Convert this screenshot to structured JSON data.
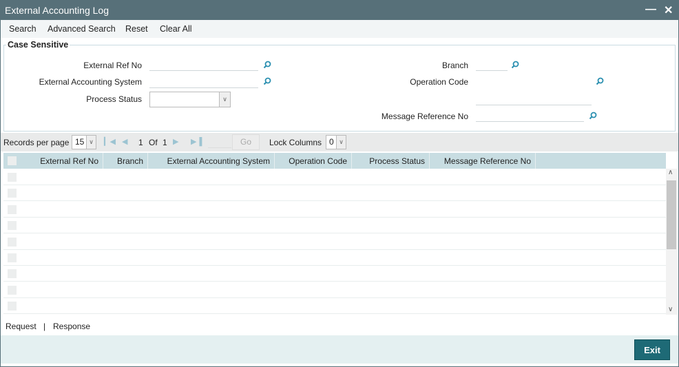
{
  "window": {
    "title": "External Accounting Log",
    "minimize_icon": "minus-icon",
    "close_icon": "x-icon"
  },
  "toolbar": {
    "search": "Search",
    "advanced_search": "Advanced Search",
    "reset": "Reset",
    "clear_all": "Clear All"
  },
  "form": {
    "legend": "Case Sensitive",
    "external_ref_no": {
      "label": "External Ref No",
      "value": ""
    },
    "external_accounting_system": {
      "label": "External Accounting System",
      "value": ""
    },
    "process_status": {
      "label": "Process Status",
      "value": ""
    },
    "branch": {
      "label": "Branch",
      "value": ""
    },
    "operation_code": {
      "label": "Operation Code",
      "value": ""
    },
    "message_reference_no": {
      "label": "Message Reference No",
      "value": ""
    }
  },
  "pager": {
    "records_label": "Records per page",
    "records_value": "15",
    "current": "1",
    "of_label": "Of",
    "total": "1",
    "go": "Go",
    "lock_label": "Lock Columns",
    "lock_value": "0"
  },
  "table": {
    "columns": [
      "External Ref No",
      "Branch",
      "External Accounting System",
      "Operation Code",
      "Process Status",
      "Message Reference No"
    ],
    "rows": []
  },
  "bottom": {
    "request": "Request",
    "separator": "|",
    "response": "Response"
  },
  "footer": {
    "exit": "Exit"
  },
  "colors": {
    "titlebar": "#577079",
    "accent": "#1e6a76",
    "header": "#c8dde2",
    "search_icon": "#2a8fb0"
  }
}
